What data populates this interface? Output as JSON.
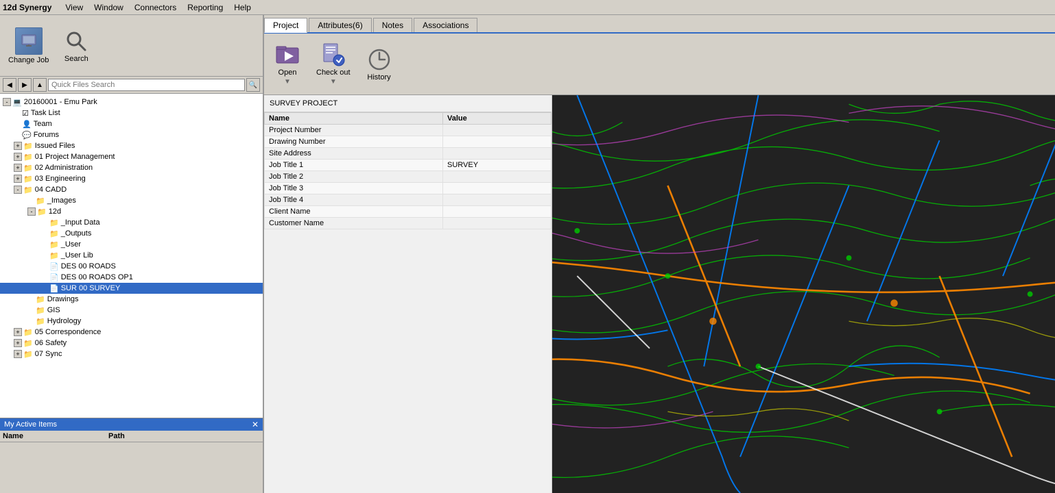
{
  "app": {
    "title": "12d Synergy",
    "menu_items": [
      "View",
      "Window",
      "Connectors",
      "Reporting",
      "Help"
    ]
  },
  "toolbar": {
    "change_job_label": "Change Job",
    "search_label": "Search",
    "search_placeholder": "Quick Files Search"
  },
  "tabs": {
    "items": [
      {
        "label": "Project",
        "active": true
      },
      {
        "label": "Attributes(6)",
        "active": false
      },
      {
        "label": "Notes",
        "active": false
      },
      {
        "label": "Associations",
        "active": false
      }
    ]
  },
  "right_toolbar": {
    "open_label": "Open",
    "checkout_label": "Check out",
    "history_label": "History"
  },
  "survey_panel": {
    "title": "SURVEY PROJECT"
  },
  "attributes": {
    "headers": [
      "Name",
      "Value"
    ],
    "rows": [
      {
        "name": "Project Number",
        "value": ""
      },
      {
        "name": "Drawing Number",
        "value": ""
      },
      {
        "name": "Site Address",
        "value": ""
      },
      {
        "name": "Job Title 1",
        "value": "SURVEY"
      },
      {
        "name": "Job Title 2",
        "value": ""
      },
      {
        "name": "Job Title 3",
        "value": ""
      },
      {
        "name": "Job Title 4",
        "value": ""
      },
      {
        "name": "Client Name",
        "value": ""
      },
      {
        "name": "Customer Name",
        "value": ""
      }
    ]
  },
  "tree": {
    "root": {
      "label": "20160001 - Emu Park",
      "expanded": true,
      "children": [
        {
          "label": "Task List",
          "icon": "✔",
          "type": "task"
        },
        {
          "label": "Team",
          "icon": "👤",
          "type": "team"
        },
        {
          "label": "Forums",
          "icon": "💬",
          "type": "forums"
        },
        {
          "label": "Issued Files",
          "icon": "📁",
          "type": "folder",
          "expanded": false
        },
        {
          "label": "01 Project Management",
          "icon": "📁",
          "type": "folder",
          "expanded": false
        },
        {
          "label": "02 Administration",
          "icon": "📁",
          "type": "folder",
          "expanded": false
        },
        {
          "label": "03 Engineering",
          "icon": "📁",
          "type": "folder",
          "expanded": false
        },
        {
          "label": "04 CADD",
          "icon": "📁",
          "type": "folder",
          "expanded": true,
          "children": [
            {
              "label": "_Images",
              "icon": "📁",
              "type": "folder",
              "indent": 1
            },
            {
              "label": "12d",
              "icon": "📁",
              "type": "folder",
              "expanded": true,
              "indent": 1,
              "children": [
                {
                  "label": "_Input Data",
                  "icon": "📁",
                  "type": "folder",
                  "indent": 2
                },
                {
                  "label": "_Outputs",
                  "icon": "📁",
                  "type": "folder",
                  "indent": 2
                },
                {
                  "label": "_User",
                  "icon": "📁",
                  "type": "folder",
                  "indent": 2
                },
                {
                  "label": "_User Lib",
                  "icon": "📁",
                  "type": "folder",
                  "indent": 2
                },
                {
                  "label": "DES 00 ROADS",
                  "icon": "📄",
                  "type": "file",
                  "indent": 2
                },
                {
                  "label": "DES 00 ROADS OP1",
                  "icon": "📄",
                  "type": "file",
                  "indent": 2
                },
                {
                  "label": "SUR 00 SURVEY",
                  "icon": "📄",
                  "type": "file",
                  "indent": 2,
                  "selected": true
                }
              ]
            },
            {
              "label": "Drawings",
              "icon": "📁",
              "type": "folder",
              "indent": 1
            },
            {
              "label": "GIS",
              "icon": "📁",
              "type": "folder",
              "indent": 1
            },
            {
              "label": "Hydrology",
              "icon": "📁",
              "type": "folder",
              "indent": 1
            }
          ]
        },
        {
          "label": "05 Correspondence",
          "icon": "📁",
          "type": "folder",
          "expanded": false
        },
        {
          "label": "06 Safety",
          "icon": "📁",
          "type": "folder",
          "expanded": false
        },
        {
          "label": "07 Sync",
          "icon": "📁",
          "type": "folder",
          "expanded": false
        }
      ]
    }
  },
  "bottom_panel": {
    "title": "My Active Items",
    "columns": [
      "Name",
      "Path"
    ]
  }
}
